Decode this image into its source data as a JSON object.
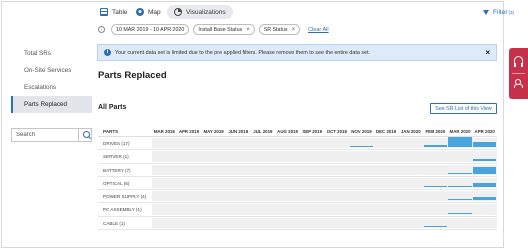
{
  "views": [
    {
      "label": "Table",
      "icon": "table-icon"
    },
    {
      "label": "Map",
      "icon": "map-icon"
    },
    {
      "label": "Visualizations",
      "icon": "visualizations-icon"
    }
  ],
  "filter": {
    "label": "Filter",
    "count": "(3)"
  },
  "chips": [
    {
      "label": "10 MAR 2019 - 10 APR 2020"
    },
    {
      "label": "Install Base Status"
    },
    {
      "label": "SR Status"
    }
  ],
  "clear_all": "Clear All",
  "sidebar": {
    "items": [
      {
        "label": "Total SRs"
      },
      {
        "label": "On-Site Services"
      },
      {
        "label": "Escalations"
      },
      {
        "label": "Parts Replaced"
      }
    ],
    "active_index": 3
  },
  "search": {
    "placeholder": "Search"
  },
  "alert": {
    "message": "Your current data set is limited due to the pre applied filters. Please remove them to see the entire data set."
  },
  "page_title": "Parts Replaced",
  "section_title": "All Parts",
  "see_list_button": "See SR List of this View",
  "accent": "#2f6db5",
  "bar_color": "#4aa4dc",
  "chart_data": {
    "type": "bar",
    "row_header": "PARTS",
    "months": [
      "MAR 2019",
      "APR 2019",
      "MAY 2019",
      "JUN 2019",
      "JUL 2019",
      "AUG 2019",
      "SEP 2019",
      "OCT 2019",
      "NOV 2019",
      "DEC 2019",
      "JAN 2020",
      "FEB 2020",
      "MAR 2020",
      "APR 2020"
    ],
    "rows": [
      {
        "label": "DRIVES (17)",
        "values": [
          0,
          0,
          0,
          0,
          0,
          0,
          0,
          0,
          1,
          0,
          0,
          2,
          9,
          5
        ]
      },
      {
        "label": "SERVER (1)",
        "values": [
          0,
          0,
          0,
          0,
          0,
          0,
          0,
          0,
          0,
          0,
          0,
          0,
          0,
          1
        ]
      },
      {
        "label": "BATTERY (7)",
        "values": [
          0,
          0,
          0,
          0,
          0,
          0,
          0,
          0,
          0,
          0,
          0,
          0,
          1,
          6
        ]
      },
      {
        "label": "OPTICAL (6)",
        "values": [
          0,
          0,
          0,
          0,
          0,
          0,
          0,
          0,
          0,
          0,
          0,
          1,
          1,
          4
        ]
      },
      {
        "label": "POWER SUPPLY (4)",
        "values": [
          0,
          0,
          0,
          0,
          0,
          0,
          0,
          0,
          0,
          0,
          0,
          0,
          1,
          3
        ]
      },
      {
        "label": "PC ASSEMBLY (1)",
        "values": [
          0,
          0,
          0,
          0,
          0,
          0,
          0,
          0,
          0,
          0,
          0,
          0,
          1,
          0
        ]
      },
      {
        "label": "CABLE (1)",
        "values": [
          0,
          0,
          0,
          0,
          0,
          0,
          0,
          0,
          0,
          0,
          0,
          1,
          0,
          0
        ]
      }
    ],
    "max_value": 9
  }
}
